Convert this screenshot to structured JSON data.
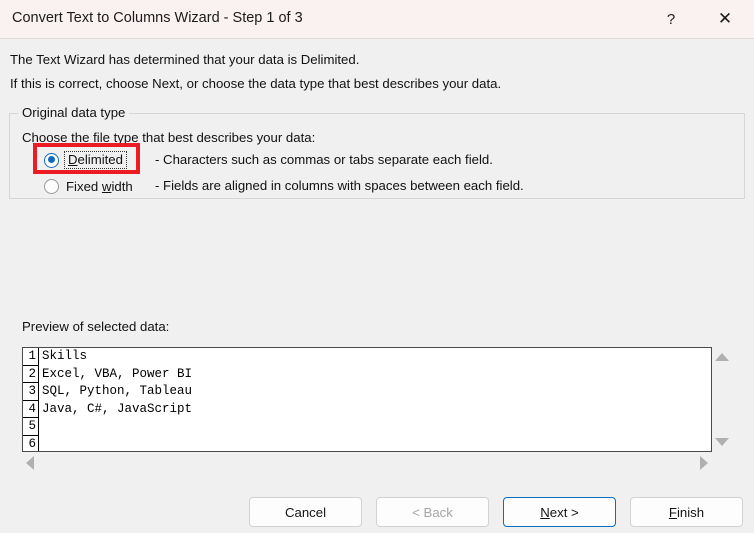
{
  "window": {
    "title": "Convert Text to Columns Wizard - Step 1 of 3",
    "help_label": "?",
    "close_label": "✕"
  },
  "intro": {
    "line1": "The Text Wizard has determined that your data is Delimited.",
    "line2": "If this is correct, choose Next, or choose the data type that best describes your data."
  },
  "original_data_type": {
    "legend": "Original data type",
    "choose_label": "Choose the file type that best describes your data:",
    "options": [
      {
        "accel": "D",
        "rest": "elimited",
        "description": "- Characters such as commas or tabs separate each field.",
        "selected": "true"
      },
      {
        "pre": "Fixed ",
        "accel": "w",
        "rest": "idth",
        "description": "- Fields are aligned in columns with spaces between each field.",
        "selected": "false"
      }
    ],
    "highlight_color": "#ec1c24"
  },
  "preview": {
    "label": "Preview of selected data:",
    "rows": [
      {
        "num": "1",
        "text": "Skills"
      },
      {
        "num": "2",
        "text": "Excel, VBA, Power BI"
      },
      {
        "num": "3",
        "text": "SQL, Python, Tableau"
      },
      {
        "num": "4",
        "text": "Java, C#, JavaScript"
      },
      {
        "num": "5",
        "text": ""
      },
      {
        "num": "6",
        "text": ""
      }
    ]
  },
  "footer": {
    "cancel": "Cancel",
    "back": "< Back",
    "next_accel": "N",
    "next_rest": "ext >",
    "finish_accel": "F",
    "finish_rest": "inish"
  },
  "colors": {
    "titlebar": "#faf1f1",
    "dialog_bg": "#f0f0f0",
    "accent": "#0f6cbd",
    "annotation": "#ec1c24"
  }
}
